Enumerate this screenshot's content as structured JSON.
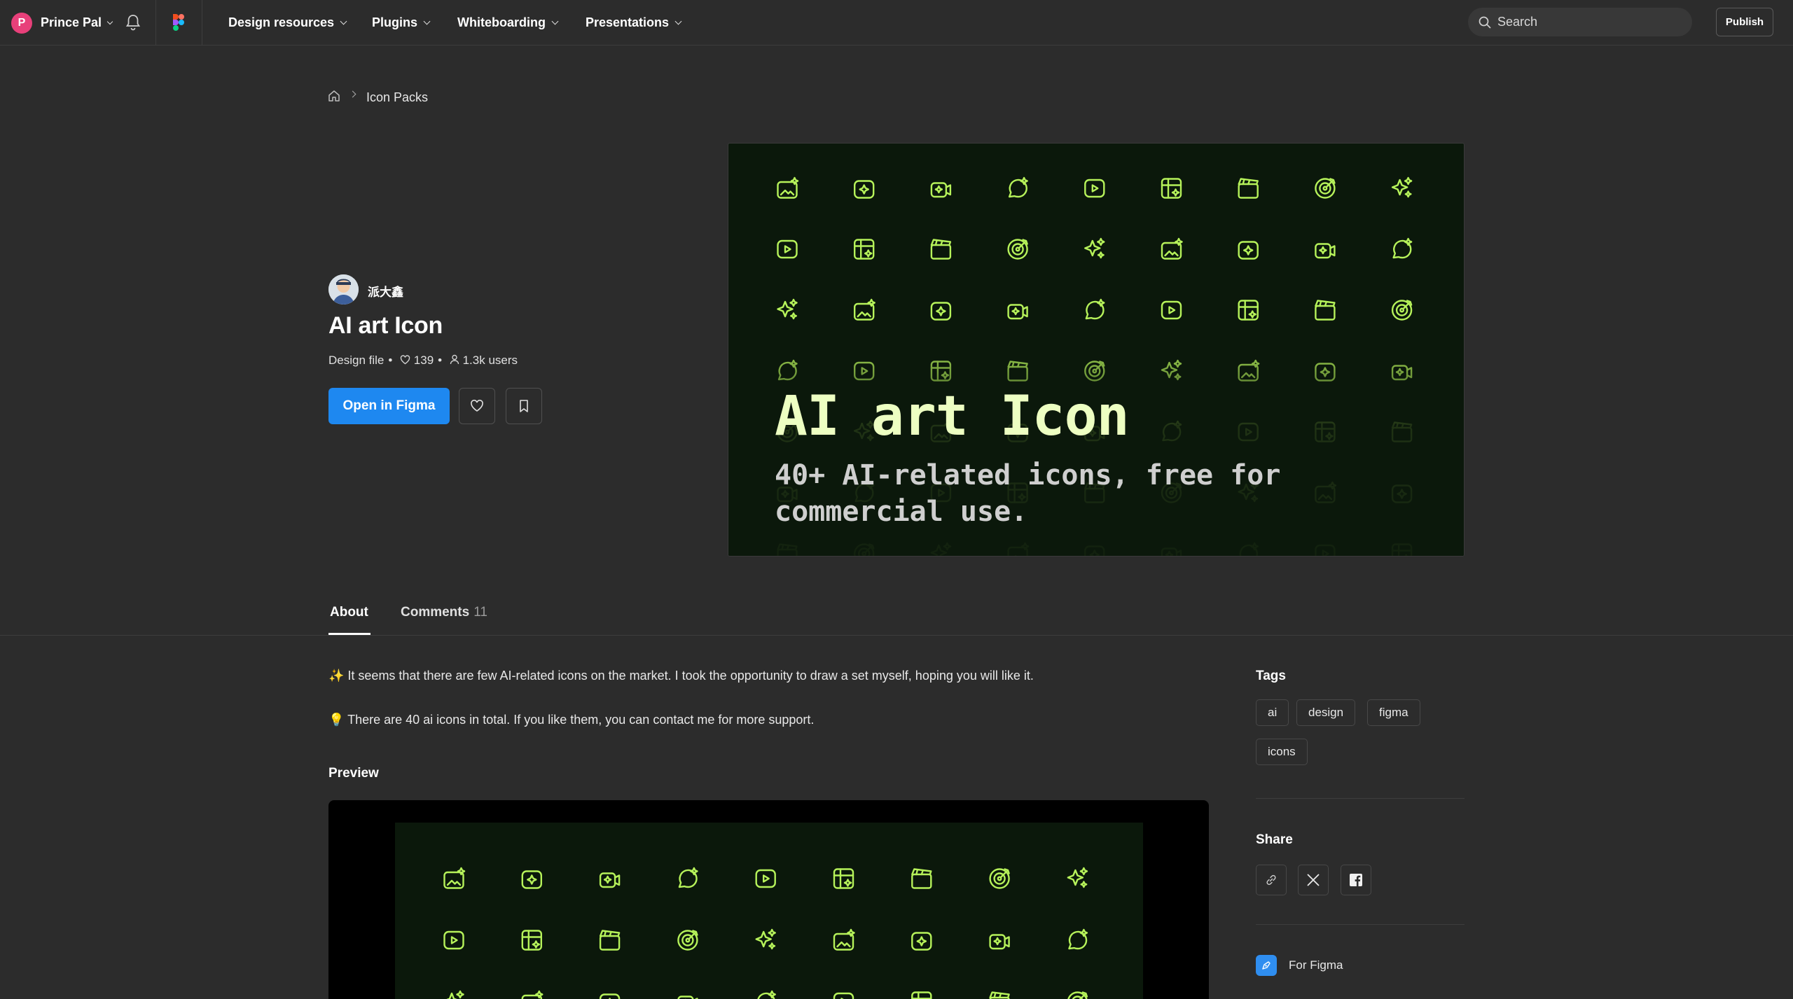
{
  "topbar": {
    "user_initial": "P",
    "user_name": "Prince Pal",
    "nav": [
      "Design resources",
      "Plugins",
      "Whiteboarding",
      "Presentations"
    ],
    "search_placeholder": "Search",
    "publish_label": "Publish"
  },
  "breadcrumb": {
    "current": "Icon Packs"
  },
  "resource": {
    "author": "派大鑫",
    "title": "AI art Icon",
    "type": "Design file",
    "likes": "139",
    "users": "1.3k users",
    "open_label": "Open in Figma"
  },
  "hero": {
    "title": "AI art Icon",
    "subtitle": "40+ AI-related icons, free for commercial use."
  },
  "tabs": {
    "about": "About",
    "comments": "Comments",
    "comments_count": "11"
  },
  "about": {
    "line1": "✨ It seems that there are few AI-related icons on the market. I took the opportunity to draw a set myself, hoping you will like it.",
    "line2": "💡 There are 40 ai icons in total. If you like them, you can contact me for more support.",
    "preview_label": "Preview"
  },
  "sidebar": {
    "tags_heading": "Tags",
    "tags": [
      "ai",
      "design",
      "figma",
      "icons"
    ],
    "share_heading": "Share",
    "for_figma": "For Figma"
  },
  "colors": {
    "accent": "#1e88f0",
    "icon_green": "#b6f25a",
    "background": "#2c2c2c"
  }
}
